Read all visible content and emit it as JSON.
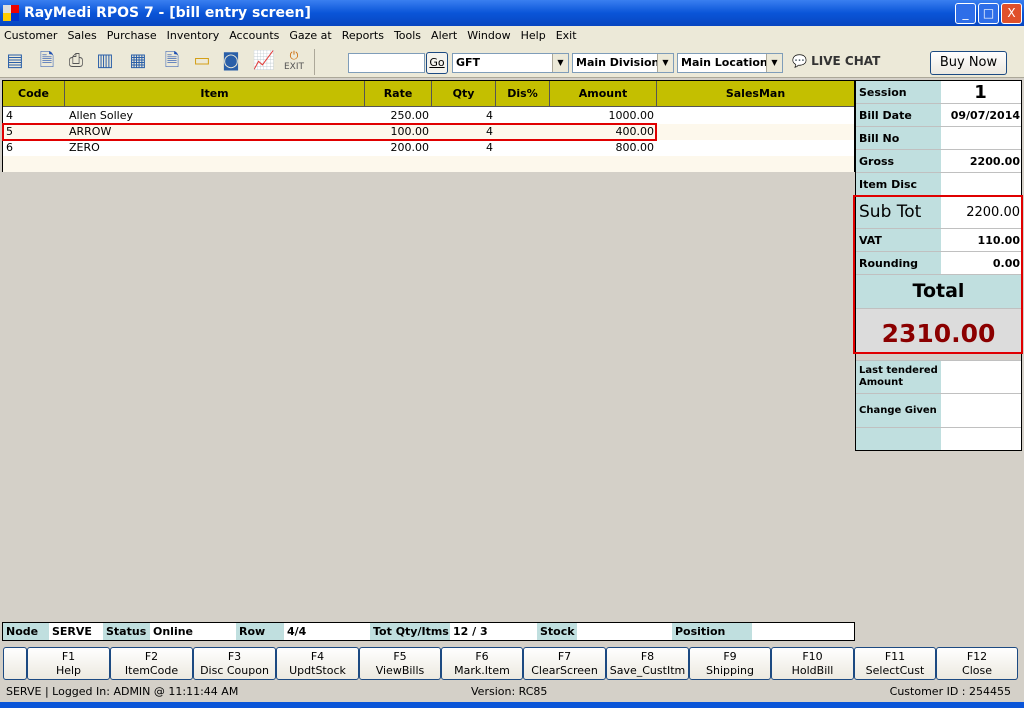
{
  "window": {
    "title": "RayMedi RPOS 7 - [bill entry screen]",
    "min": "_",
    "max": "□",
    "close": "X"
  },
  "menu": [
    "Customer",
    "Sales",
    "Purchase",
    "Inventory",
    "Accounts",
    "Gaze at",
    "Reports",
    "Tools",
    "Alert",
    "Window",
    "Help",
    "Exit"
  ],
  "toolbar": {
    "exit_label": "EXIT",
    "search_value": "",
    "go_label": "Go",
    "type_select": "GFT",
    "division_select": "Main Division",
    "location_select": "Main Location",
    "live_chat": "LIVE CHAT",
    "buy_now": "Buy Now"
  },
  "grid": {
    "columns": [
      "Code",
      "Item",
      "Rate",
      "Qty",
      "Dis%",
      "Amount",
      "SalesMan"
    ],
    "rows": [
      {
        "code": "4",
        "item": "Allen Solley",
        "rate": "250.00",
        "qty": "4",
        "dis": "",
        "amount": "1000.00",
        "salesman": ""
      },
      {
        "code": "5",
        "item": "ARROW",
        "rate": "100.00",
        "qty": "4",
        "dis": "",
        "amount": "400.00",
        "salesman": ""
      },
      {
        "code": "6",
        "item": "ZERO",
        "rate": "200.00",
        "qty": "4",
        "dis": "",
        "amount": "800.00",
        "salesman": ""
      }
    ]
  },
  "summary": {
    "session_label": "Session",
    "session": "1",
    "bill_date_label": "Bill Date",
    "bill_date": "09/07/2014",
    "bill_no_label": "Bill No",
    "bill_no": "",
    "gross_label": "Gross",
    "gross": "2200.00",
    "item_disc_label": "Item Disc",
    "item_disc": "",
    "sub_tot_label": "Sub Tot",
    "sub_tot": "2200.00",
    "vat_label": "VAT",
    "vat": "110.00",
    "rounding_label": "Rounding",
    "rounding": "0.00",
    "total_label": "Total",
    "total": "2310.00",
    "last_tendered_label": "Last tendered Amount",
    "last_tendered": "",
    "change_label": "Change Given",
    "change": ""
  },
  "status": {
    "node_label": "Node",
    "node": "SERVE",
    "status_label": "Status",
    "status": "Online",
    "row_label": "Row",
    "row": "4/4",
    "totqty_label": "Tot Qty/Itms",
    "totqty": "12 / 3",
    "stock_label": "Stock",
    "stock": "",
    "position_label": "Position",
    "position": ""
  },
  "fkeys": [
    {
      "k": "F1",
      "l": "Help"
    },
    {
      "k": "F2",
      "l": "ItemCode"
    },
    {
      "k": "F3",
      "l": "Disc Coupon"
    },
    {
      "k": "F4",
      "l": "UpdtStock"
    },
    {
      "k": "F5",
      "l": "ViewBills"
    },
    {
      "k": "F6",
      "l": "Mark.Item"
    },
    {
      "k": "F7",
      "l": "ClearScreen"
    },
    {
      "k": "F8",
      "l": "Save_CustItm"
    },
    {
      "k": "F9",
      "l": "Shipping"
    },
    {
      "k": "F10",
      "l": "HoldBill"
    },
    {
      "k": "F11",
      "l": "SelectCust"
    },
    {
      "k": "F12",
      "l": "Close"
    }
  ],
  "footer": {
    "login": "SERVE |  Logged In: ADMIN  @ 11:11:44 AM",
    "version": "Version: RC85",
    "customer": "Customer ID : 254455"
  },
  "colors": {
    "header": "#c4bf00",
    "label_bg": "#c0dfdf",
    "total": "#8b0000",
    "highlight": "#e00000"
  }
}
